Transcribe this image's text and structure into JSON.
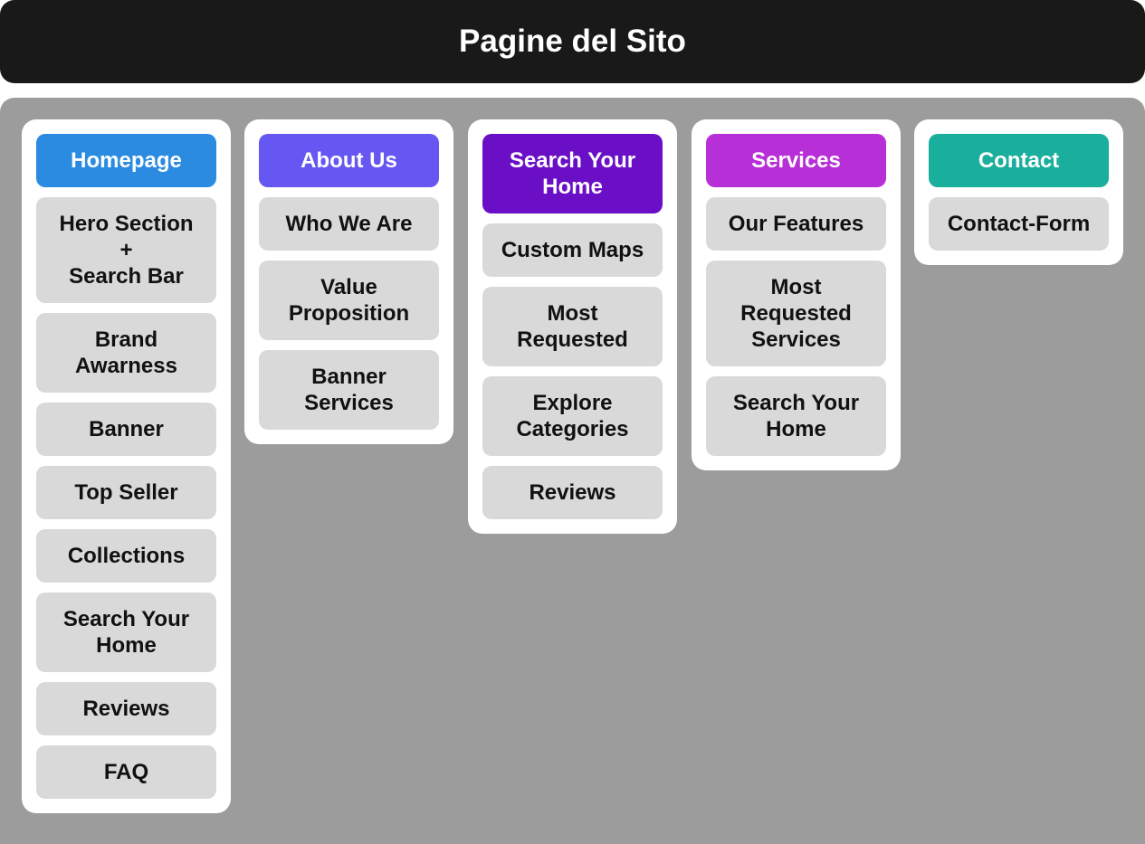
{
  "title": "Pagine del Sito",
  "colors": {
    "title_bar": "#191919",
    "board": "#9c9c9c",
    "card": "#ffffff",
    "item": "#d9d9d9"
  },
  "columns": [
    {
      "header": "Homepage",
      "color": "#2b8be0",
      "items": [
        "Hero Section\n+\nSearch Bar",
        "Brand\nAwarness",
        "Banner",
        "Top Seller",
        "Collections",
        "Search Your\nHome",
        "Reviews",
        "FAQ"
      ]
    },
    {
      "header": "About Us",
      "color": "#6657f2",
      "items": [
        "Who We Are",
        "Value\nProposition",
        "Banner\nServices"
      ]
    },
    {
      "header": "Search Your\nHome",
      "color": "#6b0fc7",
      "items": [
        "Custom Maps",
        "Most\nRequested",
        "Explore\nCategories",
        "Reviews"
      ]
    },
    {
      "header": "Services",
      "color": "#b72fd6",
      "items": [
        "Our Features",
        "Most\nRequested\nServices",
        "Search Your\nHome"
      ]
    },
    {
      "header": "Contact",
      "color": "#1aae9c",
      "items": [
        "Contact-Form"
      ]
    }
  ]
}
